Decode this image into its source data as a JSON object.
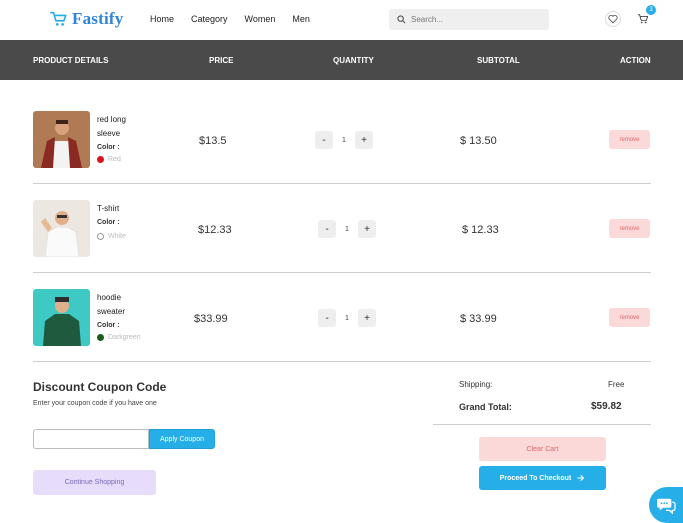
{
  "header": {
    "logo_text": "Fastify",
    "nav": [
      "Home",
      "Category",
      "Women",
      "Men"
    ],
    "search_placeholder": "Search...",
    "cart_count": "3"
  },
  "table_header": {
    "product": "PRODUCT DETAILS",
    "price": "PRICE",
    "quantity": "QUANTITY",
    "subtotal": "SUBTOTAL",
    "action": "ACTION"
  },
  "items": [
    {
      "name_line1": "red long",
      "name_line2": "sleeve",
      "color_label": "Color :",
      "color_name": "Red",
      "color_hex": "#d8141a",
      "price": "$13.5",
      "qty": "1",
      "subtotal": "$ 13.50",
      "remove_label": "remove"
    },
    {
      "name_line1": "T-shirt",
      "name_line2": "",
      "color_label": "Color :",
      "color_name": "White",
      "color_hex": "#ffffff",
      "price": "$12.33",
      "qty": "1",
      "subtotal": "$ 12.33",
      "remove_label": "remove"
    },
    {
      "name_line1": "hoodie",
      "name_line2": "sweater",
      "color_label": "Color :",
      "color_name": "Darkgreen",
      "color_hex": "#1a5c1e",
      "price": "$33.99",
      "qty": "1",
      "subtotal": "$ 33.99",
      "remove_label": "remove"
    }
  ],
  "coupon": {
    "title": "Discount Coupon Code",
    "subtitle": "Enter your coupon code if you have one",
    "input_value": "",
    "apply_label": "Apply Coupon",
    "continue_label": "Continue Shopping"
  },
  "summary": {
    "shipping_label": "Shipping:",
    "shipping_value": "Free",
    "total_label": "Grand Total:",
    "total_value": "$59.82",
    "clear_label": "Clear Cart",
    "checkout_label": "Proceed To Checkout"
  },
  "colors": {
    "accent": "#26aee8",
    "header_bg": "#4a4a4a",
    "remove_bg": "#fbd9d9"
  }
}
